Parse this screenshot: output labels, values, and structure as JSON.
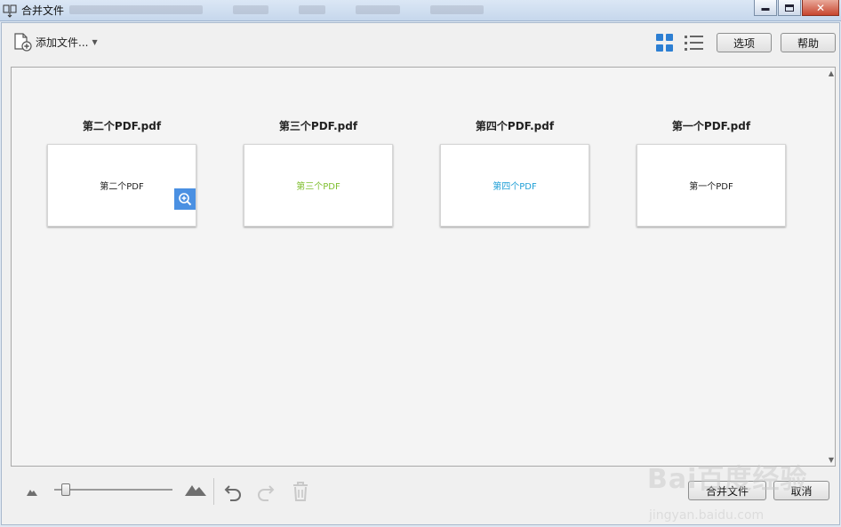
{
  "titlebar": {
    "title": "合并文件",
    "icon": "merge-app-icon",
    "buttons": {
      "minimize": "minimize-icon",
      "maximize": "maximize-icon",
      "close": "close-icon"
    }
  },
  "toolbar": {
    "add_files_label": "添加文件...",
    "add_files_icon": "add-file-icon",
    "dropdown_icon": "chevron-down-icon",
    "thumbnail_view_icon": "grid-view-icon",
    "list_view_icon": "list-view-icon",
    "options_label": "选项",
    "help_label": "帮助"
  },
  "files": [
    {
      "name": "第二个PDF.pdf",
      "preview_text": "第二个PDF",
      "preview_color": "#222222",
      "hovered": true
    },
    {
      "name": "第三个PDF.pdf",
      "preview_text": "第三个PDF",
      "preview_color": "#7fbf2f",
      "hovered": false
    },
    {
      "name": "第四个PDF.pdf",
      "preview_text": "第四个PDF",
      "preview_color": "#1f9fd6",
      "hovered": false
    },
    {
      "name": "第一个PDF.pdf",
      "preview_text": "第一个PDF",
      "preview_color": "#222222",
      "hovered": false
    }
  ],
  "bottom": {
    "zoom_out_icon": "small-mountain-icon",
    "zoom_in_icon": "large-mountain-icon",
    "zoom_level": 0.07,
    "undo_icon": "undo-icon",
    "redo_icon": "redo-icon",
    "delete_icon": "trash-icon",
    "merge_label": "合并文件",
    "cancel_label": "取消"
  },
  "watermark": {
    "logo": "Bai百度经验",
    "url": "jingyan.baidu.com"
  },
  "colors": {
    "accent": "#2d7fd3",
    "zoom_badge": "#4a90e2"
  }
}
